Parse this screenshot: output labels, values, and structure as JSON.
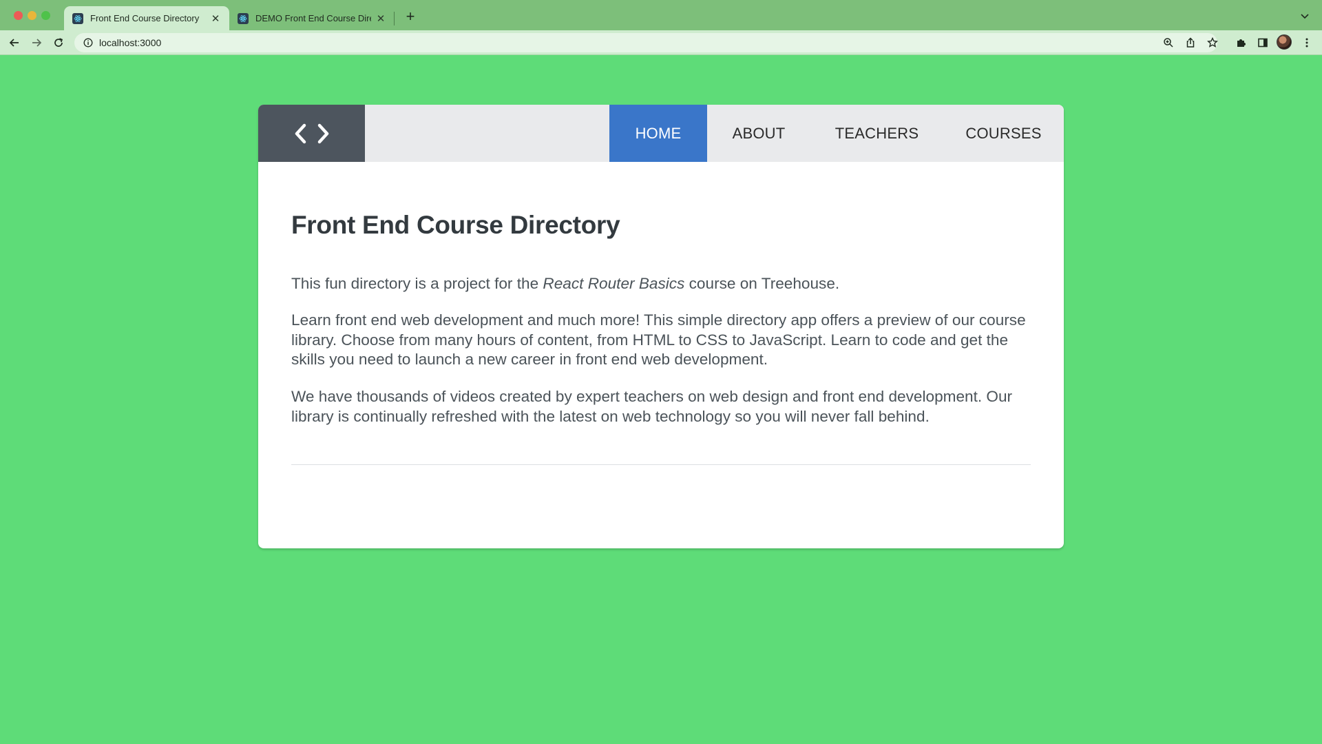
{
  "browser": {
    "tabs": [
      {
        "title": "Front End Course Directory",
        "active": true
      },
      {
        "title": "DEMO Front End Course Directory",
        "active": false
      }
    ],
    "address": {
      "url": "localhost:3000"
    }
  },
  "site": {
    "logo_icon": "code-brackets-icon",
    "nav": [
      {
        "label": "HOME",
        "active": true
      },
      {
        "label": "ABOUT",
        "active": false
      },
      {
        "label": "TEACHERS",
        "active": false
      },
      {
        "label": "COURSES",
        "active": false
      }
    ],
    "colors": {
      "background": "#5edc78",
      "header": "#e9eaec",
      "logo_bg": "#4d555e",
      "nav_active": "#3a76c9"
    }
  },
  "content": {
    "title": "Front End Course Directory",
    "intro": {
      "before": "This fun directory is a project for the ",
      "course_name": "React Router Basics",
      "after": " course on Treehouse."
    },
    "paragraph_2": "Learn front end web development and much more! This simple directory app offers a preview of our course library. Choose from many hours of content, from HTML to CSS to JavaScript. Learn to code and get the skills you need to launch a new career in front end web development.",
    "paragraph_3": "We have thousands of videos created by expert teachers on web design and front end development. Our library is continually refreshed with the latest on web technology so you will never fall behind."
  }
}
